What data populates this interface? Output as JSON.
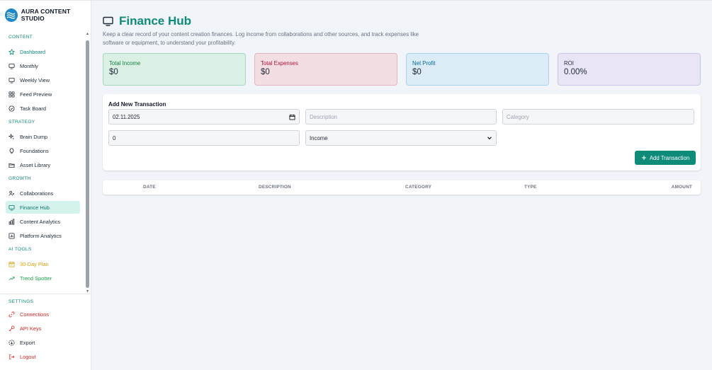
{
  "brand": {
    "title": "AURA CONTENT STUDIO"
  },
  "sidebar": {
    "sections": [
      {
        "title": "CONTENT",
        "items": [
          {
            "label": "Dashboard",
            "icon": "star-icon"
          },
          {
            "label": "Monthly",
            "icon": "monitor-icon"
          },
          {
            "label": "Weekly View",
            "icon": "monitor-icon"
          },
          {
            "label": "Feed Preview",
            "icon": "grid-icon"
          },
          {
            "label": "Task Board",
            "icon": "check-circle-icon"
          }
        ]
      },
      {
        "title": "STRATEGY",
        "items": [
          {
            "label": "Brain Dump",
            "icon": "sparkle-icon"
          },
          {
            "label": "Foundations",
            "icon": "lightbulb-icon"
          },
          {
            "label": "Asset Library",
            "icon": "folder-icon"
          }
        ]
      },
      {
        "title": "GROWTH",
        "items": [
          {
            "label": "Collaborations",
            "icon": "users-icon"
          },
          {
            "label": "Finance Hub",
            "icon": "monitor-icon"
          },
          {
            "label": "Content Analytics",
            "icon": "bar-chart-icon"
          },
          {
            "label": "Platform Analytics",
            "icon": "chart-box-icon"
          }
        ]
      },
      {
        "title": "AI TOOLS",
        "items": [
          {
            "label": "30-Day Plan",
            "icon": "calendar-icon"
          },
          {
            "label": "Trend Spotter",
            "icon": "trend-up-icon"
          }
        ]
      }
    ],
    "settings": {
      "title": "SETTINGS",
      "items": [
        {
          "label": "Connections",
          "icon": "link-icon"
        },
        {
          "label": "API Keys",
          "icon": "key-icon"
        },
        {
          "label": "Export",
          "icon": "export-icon"
        },
        {
          "label": "Logout",
          "icon": "logout-icon"
        }
      ]
    }
  },
  "page": {
    "title": "Finance Hub",
    "description": "Keep a clear record of your content creation finances. Log income from collaborations and other sources, and track expenses like software or equipment, to understand your profitability."
  },
  "cards": [
    {
      "label": "Total Income",
      "value": "$0"
    },
    {
      "label": "Total Expenses",
      "value": "$0"
    },
    {
      "label": "Net Profit",
      "value": "$0"
    },
    {
      "label": "ROI",
      "value": "0.00%"
    }
  ],
  "form": {
    "title": "Add New Transaction",
    "date_value": "02.11.2025",
    "description_placeholder": "Description",
    "category_placeholder": "Category",
    "amount_value": "0",
    "type_value": "Income",
    "submit_label": "Add Transaction"
  },
  "table": {
    "columns": [
      "DATE",
      "DESCRIPTION",
      "CATEGORY",
      "TYPE",
      "AMOUNT"
    ]
  },
  "colors": {
    "accent": "#0f8b7a",
    "active_bg": "#d4f3ec"
  }
}
